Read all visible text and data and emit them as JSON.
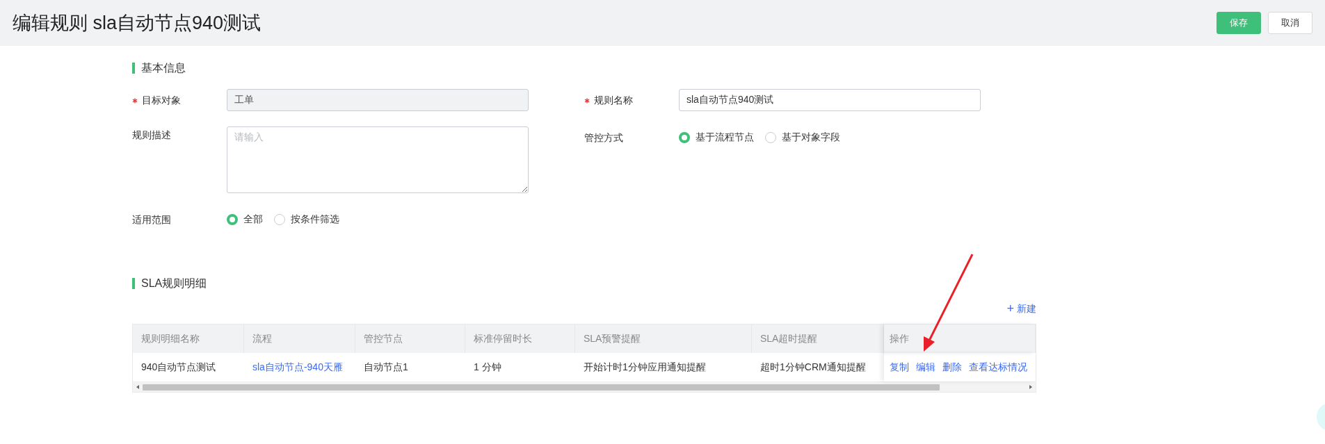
{
  "header": {
    "title": "编辑规则 sla自动节点940测试",
    "buttons": [
      {
        "label": "保存",
        "kind": "primary"
      },
      {
        "label": "取消",
        "kind": "default"
      }
    ]
  },
  "basic_info": {
    "title": "基本信息",
    "fields": [
      {
        "label": "目标对象",
        "required": true,
        "kind": "input",
        "value": "工单",
        "disabled": true
      },
      {
        "label": "规则名称",
        "required": true,
        "kind": "input",
        "value": "sla自动节点940测试",
        "disabled": false
      },
      {
        "label": "规则描述",
        "required": false,
        "kind": "textarea",
        "placeholder": "请输入"
      },
      {
        "label": "管控方式",
        "required": false,
        "kind": "radio",
        "options": [
          {
            "label": "基于流程节点",
            "selected": true
          },
          {
            "label": "基于对象字段",
            "selected": false
          }
        ]
      },
      {
        "label": "适用范围",
        "required": false,
        "kind": "radio",
        "options": [
          {
            "label": "全部",
            "selected": true
          },
          {
            "label": "按条件筛选",
            "selected": false
          }
        ]
      }
    ]
  },
  "sla_details": {
    "title": "SLA规则明细",
    "new_button": {
      "icon": "+",
      "label": "新建"
    },
    "table": {
      "columns": [
        "规则明细名称",
        "流程",
        "管控节点",
        "标准停留时长",
        "SLA预警提醒",
        "SLA超时提醒",
        "操作"
      ],
      "rows": [
        {
          "cells": [
            {
              "text": "940自动节点测试",
              "kind": "text"
            },
            {
              "text": "sla自动节点-940天雁",
              "kind": "link"
            },
            {
              "text": "自动节点1",
              "kind": "text"
            },
            {
              "text": "1 分钟",
              "kind": "text"
            },
            {
              "text": "开始计时1分钟应用通知提醒",
              "kind": "text"
            },
            {
              "text": "超时1分钟CRM通知提醒",
              "kind": "text"
            }
          ],
          "actions": [
            "复制",
            "编辑",
            "删除",
            "查看达标情况"
          ]
        }
      ]
    }
  }
}
